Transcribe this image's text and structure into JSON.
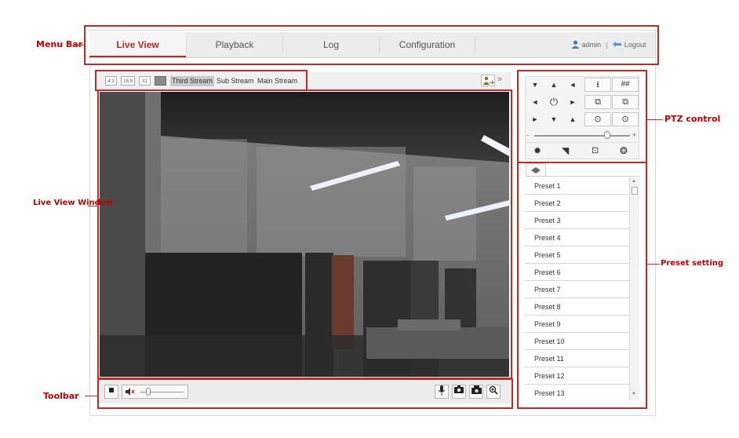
{
  "annotations": {
    "menu_bar": "Menu Bar",
    "live_view_window": "Live View Window",
    "toolbar": "Toolbar",
    "ptz_control": "PTZ control",
    "preset_setting": "Preset setting"
  },
  "menu": {
    "tabs": [
      {
        "label": "Live View",
        "active": true
      },
      {
        "label": "Playback",
        "active": false
      },
      {
        "label": "Log",
        "active": false
      },
      {
        "label": "Configuration",
        "active": false
      }
    ],
    "user": "admin",
    "separator": "|",
    "logout": "Logout"
  },
  "stream_bar": {
    "ratios": [
      "4:3",
      "16:9",
      "X1"
    ],
    "streams": [
      {
        "label": "Third Stream",
        "selected": true
      },
      {
        "label": "Sub Stream",
        "selected": false
      },
      {
        "label": "Main Stream",
        "selected": false
      }
    ],
    "expand": "»"
  },
  "toolbar": {
    "volume_level": 0.15,
    "icons": [
      "stop-icon",
      "speaker-icon",
      "microphone-icon",
      "camera-icon",
      "record-icon",
      "zoom-icon"
    ]
  },
  "ptz": {
    "slider_level": 0.75,
    "minus": "-",
    "plus": "+"
  },
  "presets": [
    "Preset 1",
    "Preset 2",
    "Preset 3",
    "Preset 4",
    "Preset 5",
    "Preset 6",
    "Preset 7",
    "Preset 8",
    "Preset 9",
    "Preset 10",
    "Preset 11",
    "Preset 12",
    "Preset 13"
  ],
  "colors": {
    "accent": "#b72a1f",
    "annotation": "#c62828"
  }
}
